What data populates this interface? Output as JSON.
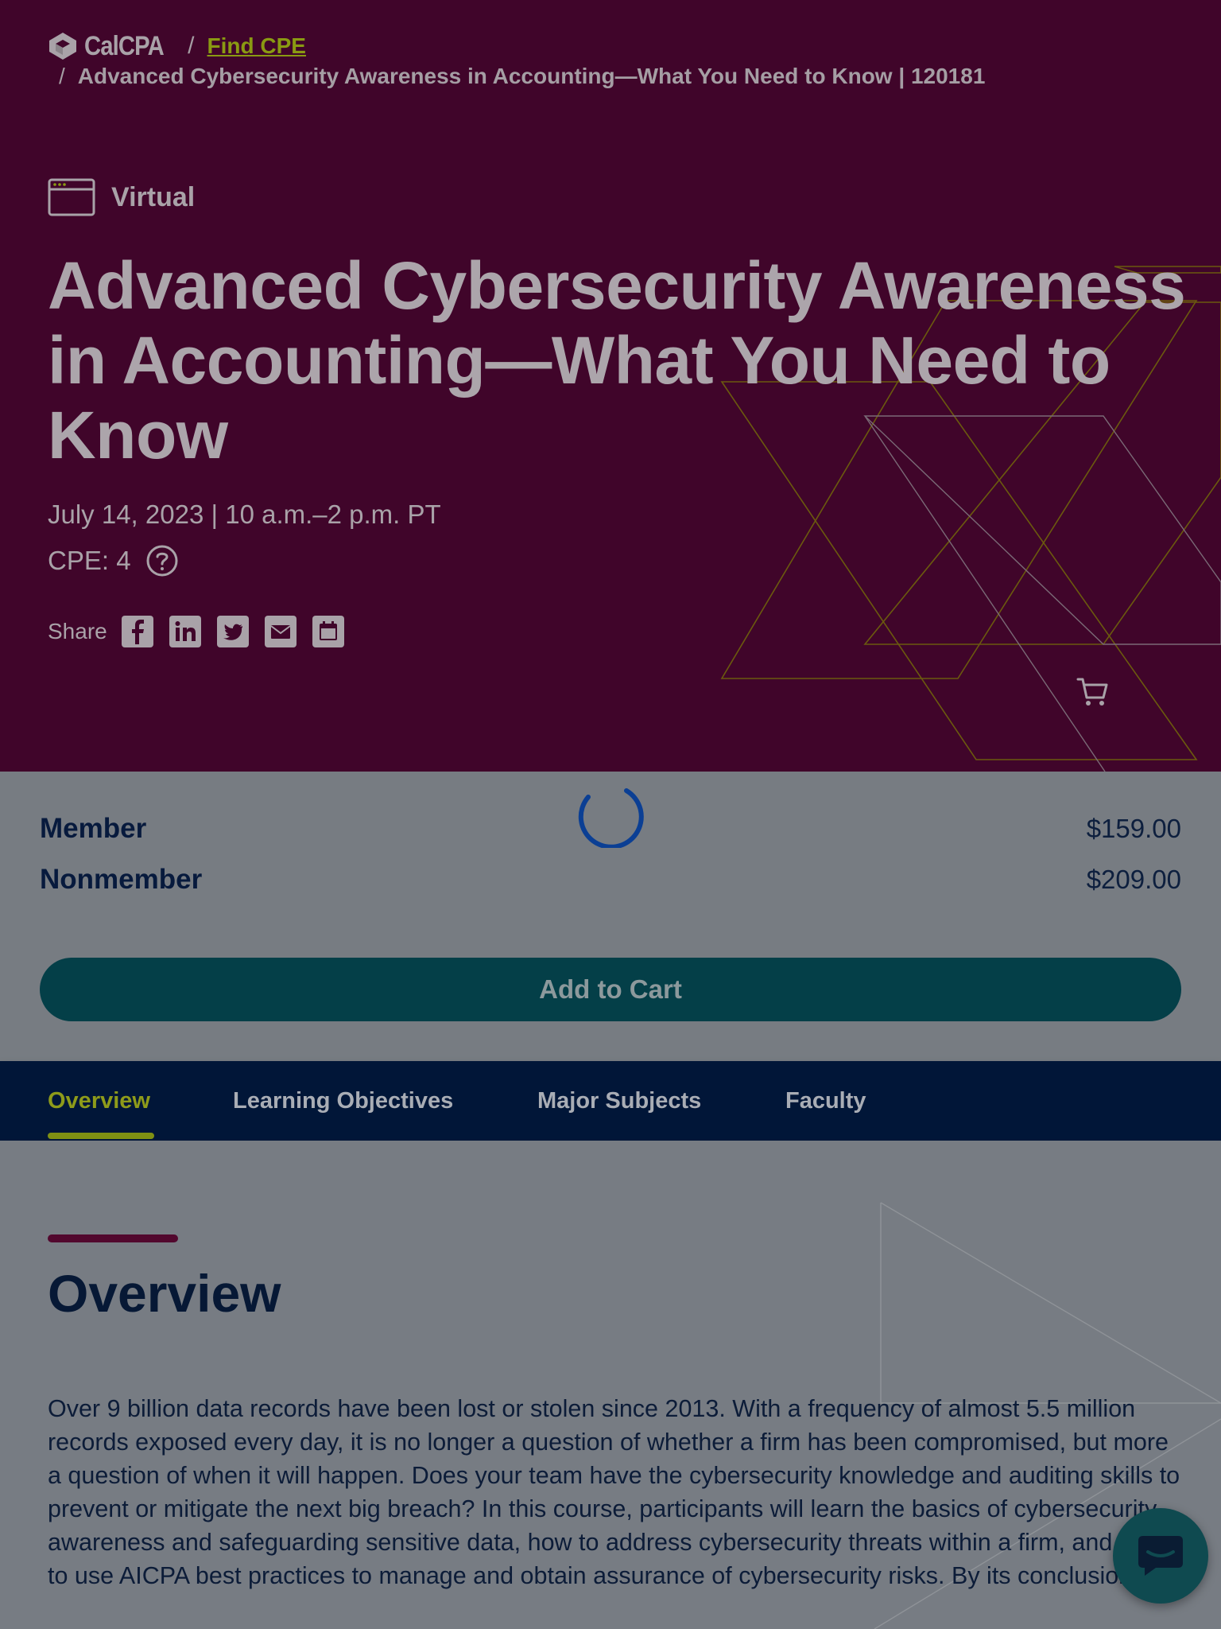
{
  "breadcrumb": {
    "logo_text": "CalCPA",
    "separator": "/",
    "link": "Find CPE",
    "current": "Advanced Cybersecurity Awareness in Accounting—What You Need to Know | 120181"
  },
  "event": {
    "format": "Virtual",
    "title": "Advanced Cybersecurity Awareness in Accounting—What You Need to Know",
    "dateline": "July 14, 2023 | 10 a.m.–2 p.m. PT",
    "cpe": "CPE: 4",
    "share_label": "Share",
    "share_icons": [
      "facebook-icon",
      "linkedin-icon",
      "twitter-icon",
      "email-icon",
      "calendar-icon"
    ]
  },
  "pricing": {
    "member_label": "Member",
    "member_price": "$159.00",
    "nonmember_label": "Nonmember",
    "nonmember_price": "$209.00",
    "add_to_cart": "Add to Cart"
  },
  "tabs": [
    {
      "label": "Overview",
      "active": true
    },
    {
      "label": "Learning Objectives",
      "active": false
    },
    {
      "label": "Major Subjects",
      "active": false
    },
    {
      "label": "Faculty",
      "active": false
    }
  ],
  "overview": {
    "heading": "Overview",
    "text": "Over 9 billion data records have been lost or stolen since 2013. With a frequency of almost 5.5 million records exposed every day, it is no longer a question of whether a firm has been compromised, but more a question of when it will happen. Does your team have the cybersecurity knowledge and auditing skills to prevent or mitigate the next big breach? In this course, participants will learn the basics of cybersecurity awareness and safeguarding sensitive data, how to address cybersecurity threats within a firm, and how to use AICPA best practices to manage and obtain assurance of cybersecurity risks. By its conclusion,"
  },
  "colors": {
    "hero_bg": "#40052a",
    "accent_green": "#8e9b1a",
    "navy": "#011638",
    "teal_button": "#043f48",
    "overlay_gray": "#777c82"
  }
}
